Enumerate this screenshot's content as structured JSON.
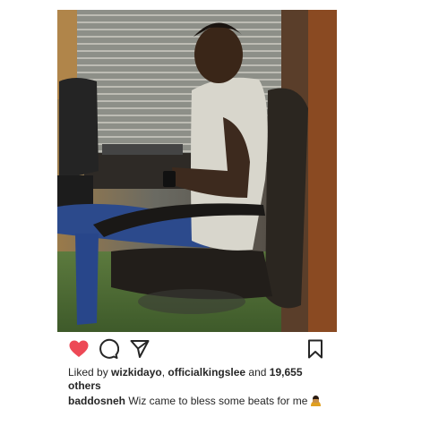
{
  "post": {
    "image_alt": "Man in white t-shirt seated in leather office chair looking at phone",
    "actions": {
      "like_icon": "heart-filled-icon",
      "comment_icon": "comment-icon",
      "share_icon": "send-icon",
      "save_icon": "bookmark-icon"
    },
    "likes": {
      "prefix": "Liked by ",
      "user1": "wizkidayo",
      "sep": ", ",
      "user2": "officialkingslee",
      "and": " and ",
      "count": "19,655",
      "others": "others"
    },
    "caption": {
      "username": "baddosneh",
      "text": "Wiz came to bless some beats for me",
      "emoji_icon": "person-bowing-emoji"
    },
    "colors": {
      "like_red": "#ed4956",
      "text": "#262626"
    }
  }
}
